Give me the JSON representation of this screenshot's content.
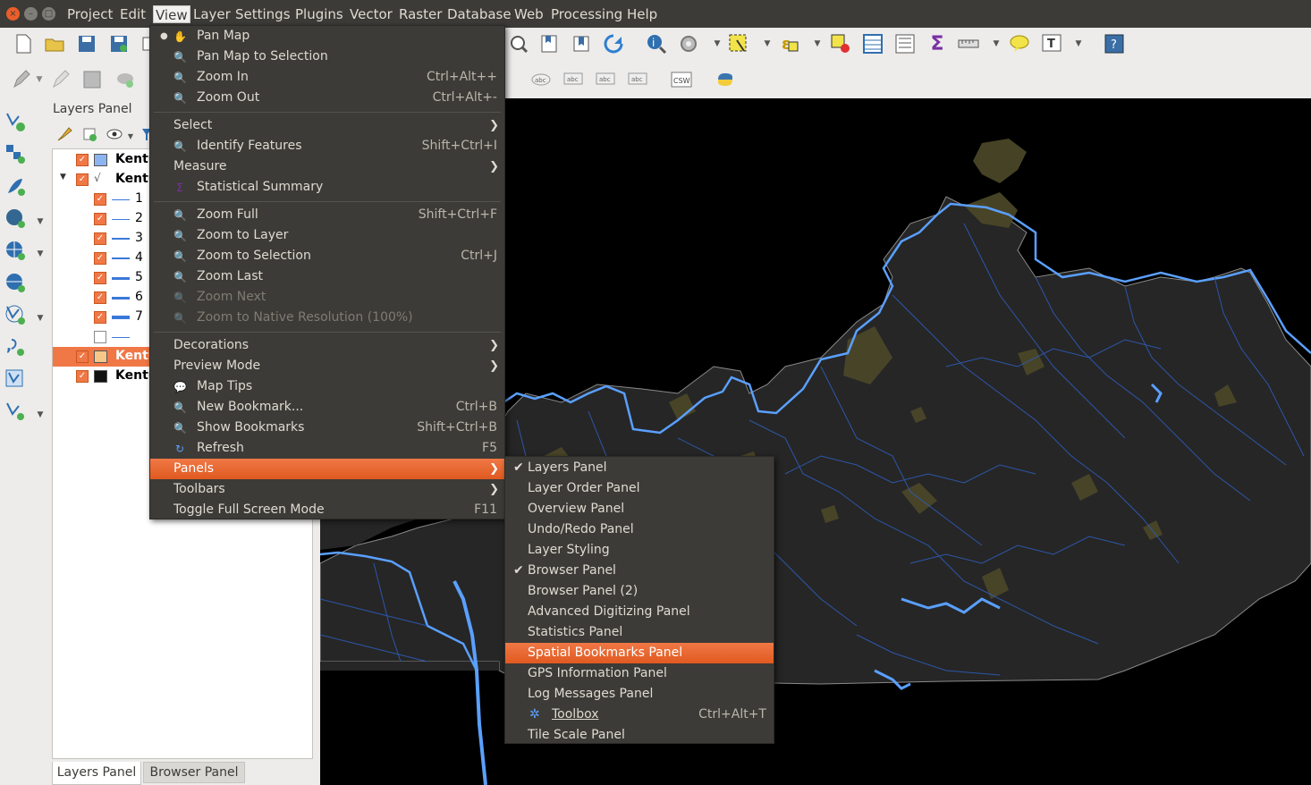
{
  "window": {
    "close_glyph": "×",
    "minimize_glyph": "–",
    "maximize_glyph": "□"
  },
  "menubar": [
    "Project",
    "Edit",
    "View",
    "Layer",
    "Settings",
    "Plugins",
    "Vector",
    "Raster",
    "Database",
    "Web",
    "Processing",
    "Help"
  ],
  "layers_panel": {
    "title": "Layers Panel",
    "layers": [
      {
        "name": "Kentu",
        "checked": true,
        "swatch": "#8cb4f0"
      },
      {
        "name": "Kentu",
        "checked": true,
        "expanded": true
      },
      {
        "name": "1",
        "checked": true
      },
      {
        "name": "2",
        "checked": true
      },
      {
        "name": "3",
        "checked": true
      },
      {
        "name": "4",
        "checked": true
      },
      {
        "name": "5",
        "checked": true
      },
      {
        "name": "6",
        "checked": true
      },
      {
        "name": "7",
        "checked": true
      },
      {
        "name": "",
        "checked": false
      },
      {
        "name": "Kentu",
        "checked": true,
        "selected": true,
        "swatch": "#f7c78a"
      },
      {
        "name": "Kentu",
        "checked": true,
        "swatch": "#111111"
      }
    ],
    "tabs": [
      "Layers Panel",
      "Browser Panel"
    ]
  },
  "view_menu": {
    "items": [
      {
        "label": "Pan Map",
        "shortcut": "",
        "icon": "hand-icon",
        "bullet": true
      },
      {
        "label": "Pan Map to Selection",
        "shortcut": "",
        "icon": "pan-selection-icon"
      },
      {
        "label": "Zoom In",
        "shortcut": "Ctrl+Alt++",
        "icon": "zoom-in-icon"
      },
      {
        "label": "Zoom Out",
        "shortcut": "Ctrl+Alt+-",
        "icon": "zoom-out-icon"
      },
      {
        "sep": true
      },
      {
        "label": "Select",
        "submenu": true
      },
      {
        "label": "Identify Features",
        "shortcut": "Shift+Ctrl+I",
        "icon": "identify-icon"
      },
      {
        "label": "Measure",
        "submenu": true
      },
      {
        "label": "Statistical Summary",
        "shortcut": "",
        "icon": "sigma-icon"
      },
      {
        "sep": true
      },
      {
        "label": "Zoom Full",
        "shortcut": "Shift+Ctrl+F",
        "icon": "zoom-full-icon"
      },
      {
        "label": "Zoom to Layer",
        "shortcut": "",
        "icon": "zoom-layer-icon"
      },
      {
        "label": "Zoom to Selection",
        "shortcut": "Ctrl+J",
        "icon": "zoom-selection-icon"
      },
      {
        "label": "Zoom Last",
        "shortcut": "",
        "icon": "zoom-last-icon"
      },
      {
        "label": "Zoom Next",
        "shortcut": "",
        "icon": "zoom-next-icon",
        "disabled": true
      },
      {
        "label": "Zoom to Native Resolution (100%)",
        "shortcut": "",
        "icon": "zoom-native-icon",
        "disabled": true
      },
      {
        "sep": true
      },
      {
        "label": "Decorations",
        "submenu": true
      },
      {
        "label": "Preview Mode",
        "submenu": true
      },
      {
        "label": "Map Tips",
        "shortcut": "",
        "icon": "map-tips-icon"
      },
      {
        "label": "New Bookmark...",
        "shortcut": "Ctrl+B",
        "icon": "new-bookmark-icon"
      },
      {
        "label": "Show Bookmarks",
        "shortcut": "Shift+Ctrl+B",
        "icon": "show-bookmarks-icon"
      },
      {
        "label": "Refresh",
        "shortcut": "F5",
        "icon": "refresh-icon"
      },
      {
        "label": "Panels",
        "submenu": true,
        "highlighted": true
      },
      {
        "label": "Toolbars",
        "submenu": true
      },
      {
        "label": "Toggle Full Screen Mode",
        "shortcut": "F11"
      }
    ]
  },
  "panels_submenu": {
    "items": [
      {
        "label": "Layers Panel",
        "checked": true
      },
      {
        "label": "Layer Order Panel"
      },
      {
        "label": "Overview Panel"
      },
      {
        "label": "Undo/Redo Panel"
      },
      {
        "label": "Layer Styling"
      },
      {
        "label": "Browser Panel",
        "checked": true
      },
      {
        "label": "Browser Panel (2)"
      },
      {
        "label": "Advanced Digitizing Panel"
      },
      {
        "label": "Statistics Panel"
      },
      {
        "label": "Spatial Bookmarks Panel",
        "highlighted": true
      },
      {
        "label": "GPS Information Panel"
      },
      {
        "label": "Log Messages Panel"
      },
      {
        "label": "Toolbox",
        "shortcut": "Ctrl+Alt+T",
        "icon": "gear-icon"
      },
      {
        "label": "Tile Scale Panel"
      }
    ]
  },
  "colors": {
    "accent": "#f07846",
    "menu_bg": "#3c3b37",
    "river": "#5aa0ff",
    "urban": "#4a4628",
    "land": "#262626"
  }
}
